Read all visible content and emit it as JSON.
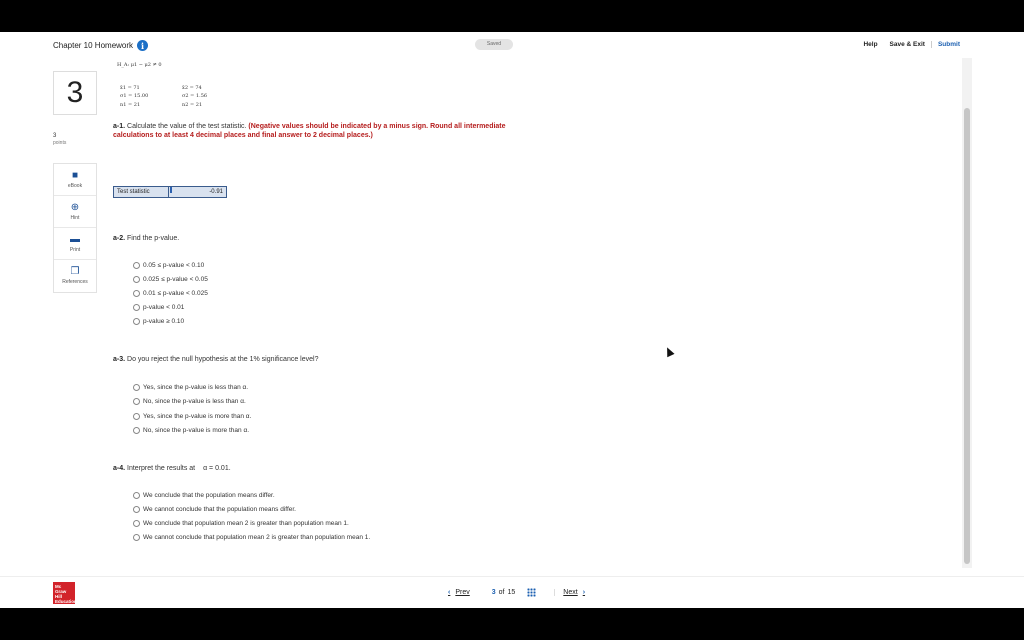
{
  "header": {
    "title": "Chapter 10 Homework",
    "status": "Saved",
    "help": "Help",
    "save_exit": "Save & Exit",
    "submit": "Submit"
  },
  "question": {
    "number": "3",
    "points_value": "3",
    "points_label": "points"
  },
  "tools": [
    {
      "label": "eBook",
      "icon": "book-icon"
    },
    {
      "label": "Hint",
      "icon": "lifebuoy-icon"
    },
    {
      "label": "Print",
      "icon": "printer-icon"
    },
    {
      "label": "References",
      "icon": "copy-icon"
    }
  ],
  "stats": {
    "hypothesis": "H_A: μ1 − μ2 ≠ 0",
    "xbar1": "x̄1 = 71",
    "sigma1": "σ1 = 15.00",
    "n1": "n1 = 21",
    "xbar2": "x̄2 = 74",
    "sigma2": "σ2 = 1.56",
    "n2": "n2 = 21"
  },
  "a1": {
    "label": "a-1.",
    "text": "Calculate the value of the test statistic.",
    "note_line1": "(Negative values should be indicated by a minus sign. Round all intermediate",
    "note_line2": "calculations to at least 4 decimal places and final answer to 2 decimal places.)",
    "row_label": "Test statistic",
    "row_value": "-0.91"
  },
  "a2": {
    "label": "a-2.",
    "text": "Find the p-value.",
    "options": [
      "0.05 ≤ p-value < 0.10",
      "0.025 ≤ p-value < 0.05",
      "0.01 ≤ p-value < 0.025",
      "p-value < 0.01",
      "p-value ≥ 0.10"
    ]
  },
  "a3": {
    "label": "a-3.",
    "text": "Do you reject the null hypothesis at the 1% significance level?",
    "options": [
      "Yes, since the p-value is less than α.",
      "No, since the p-value is less than α.",
      "Yes, since the p-value is more than α.",
      "No, since the p-value is more than α."
    ]
  },
  "a4": {
    "label": "a-4.",
    "text": "Interpret the results at",
    "alpha": "α = 0.01.",
    "options": [
      "We conclude that the population means differ.",
      "We cannot conclude that the population means differ.",
      "We conclude that population mean 2 is greater than population mean 1.",
      "We cannot conclude that population mean 2 is greater than population mean 1."
    ]
  },
  "footer": {
    "logo": "Mc Graw Hill Education",
    "prev": "Prev",
    "current_page": "3",
    "of": "of",
    "total_pages": "15",
    "next": "Next"
  }
}
